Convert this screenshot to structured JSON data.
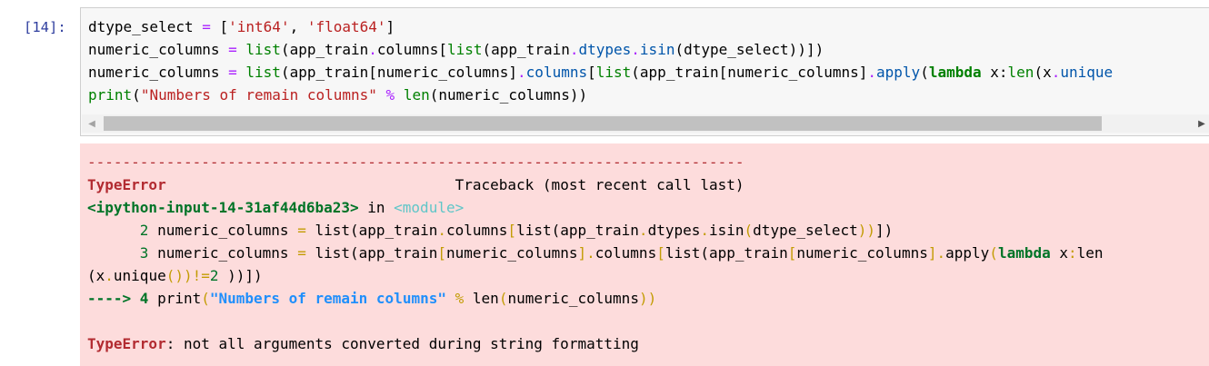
{
  "cell": {
    "prompt": "[14]:",
    "lines": {
      "l1": {
        "a": "dtype_select ",
        "eq": "=",
        "b": " [",
        "s1": "'int64'",
        "c": ", ",
        "s2": "'float64'",
        "d": "]"
      },
      "l2": {
        "a": "numeric_columns ",
        "eq": "=",
        "sp": " ",
        "fn": "list",
        "b": "(app_train",
        "dot1": ".",
        "attr1": "columns",
        "c": "[",
        "fn2": "list",
        "d": "(app_train",
        "dot2": ".",
        "attr2": "dtypes",
        "dot3": ".",
        "attr3": "isin",
        "e": "(dtype_select))])"
      },
      "l3": {
        "a": "numeric_columns ",
        "eq": "=",
        "sp": " ",
        "fn": "list",
        "b": "(app_train[numeric_columns]",
        "dot1": ".",
        "attr1": "columns",
        "c": "[",
        "fn2": "list",
        "d": "(app_train[numeric_columns]",
        "dot2": ".",
        "attr2": "apply",
        "e": "(",
        "kw": "lambda",
        "f": " x:",
        "fn3": "len",
        "g": "(x",
        "dot3": ".",
        "attr3": "unique"
      },
      "l4": {
        "fn": "print",
        "a": "(",
        "s": "\"Numbers of remain columns\"",
        "sp": " ",
        "op": "%",
        "sp2": " ",
        "fn2": "len",
        "b": "(numeric_columns))"
      }
    }
  },
  "traceback": {
    "dashes": "---------------------------------------------------------------------------",
    "error_type": "TypeError",
    "header_gap": "                                 ",
    "header_text": "Traceback (most recent call last)",
    "input_ref": "<ipython-input-14-31af44d6ba23>",
    "in_word": " in ",
    "module": "<module>",
    "line2": {
      "num": "      2",
      "a": " numeric_columns ",
      "eq": "=",
      "sp": " ",
      "fn": "list",
      "b": "(app_train",
      "dot1": ".",
      "attr1": "columns",
      "c": "[",
      "fn2": "list",
      "d": "(app_train",
      "dot2": ".",
      "attr2": "dtypes",
      "dot3": ".",
      "attr3": "isin",
      "p1": "(",
      "e": "dtype_select",
      "p2": "))",
      "p3": "])"
    },
    "line3": {
      "num": "      3",
      "a": " numeric_columns ",
      "eq": "=",
      "sp": " ",
      "fn": "list",
      "b": "(app_train",
      "br1": "[",
      "c": "numeric_columns",
      "br2": "]",
      "dot1": ".",
      "attr1": "columns",
      "br3": "[",
      "fn2": "list",
      "d": "(app_train",
      "br4": "[",
      "e": "numeric_columns",
      "br5": "]",
      "dot2": ".",
      "attr2": "apply",
      "p1": "(",
      "kw": "lambda",
      "f": " x",
      "colon": ":",
      "fn3": "len"
    },
    "line3b": {
      "a": "(x",
      "dot": ".",
      "attr": "unique",
      "p1": "())",
      "op": "!=",
      "num": "2",
      "p2": " ))])"
    },
    "arrow_line": {
      "arrow": "----> 4",
      "sp": " ",
      "fn": "print",
      "p1": "(",
      "s": "\"Numbers of remain columns\"",
      "sp2": " ",
      "op": "%",
      "sp3": " ",
      "fn2": "len",
      "p2": "(",
      "arg": "numeric_columns",
      "p3": "))"
    },
    "final_error_type": "TypeError",
    "final_message": ": not all arguments converted during string formatting"
  },
  "scrollbar": {
    "left_arrow": "◀",
    "right_arrow": "▶"
  }
}
